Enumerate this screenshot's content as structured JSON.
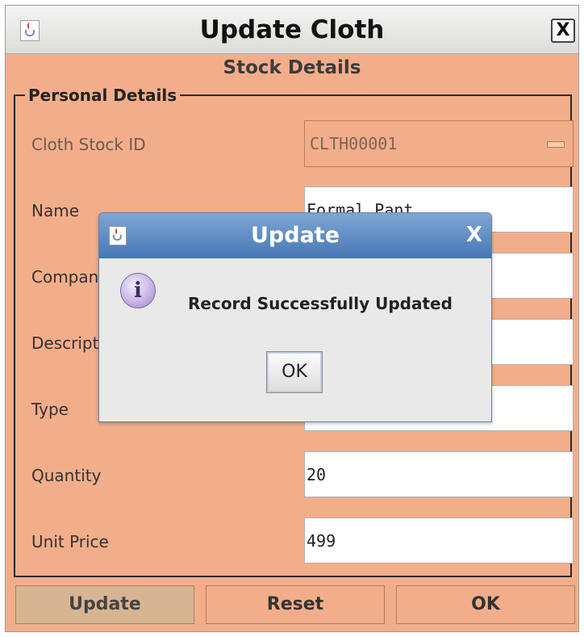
{
  "window": {
    "title": "Update Cloth",
    "close_label": "X",
    "subtitle": "Stock Details"
  },
  "form": {
    "group_label": "Personal Details",
    "fields": [
      {
        "label": "Cloth Stock ID",
        "value": "CLTH00001"
      },
      {
        "label": "Name",
        "value": "Formal Pant"
      },
      {
        "label": "Company",
        "value": ""
      },
      {
        "label": "Description",
        "value": ""
      },
      {
        "label": "Type",
        "value": ""
      },
      {
        "label": "Quantity",
        "value": "20"
      },
      {
        "label": "Unit Price",
        "value": "499"
      }
    ]
  },
  "buttons": {
    "update": "Update",
    "reset": "Reset",
    "ok": "OK"
  },
  "dialog": {
    "title": "Update",
    "close_label": "X",
    "icon": "info-icon",
    "icon_glyph": "i",
    "message": "Record Successfully Updated",
    "ok": "OK"
  },
  "colors": {
    "form_background": "#f2ae8a",
    "dialog_title_bar": "#4677b6",
    "update_button_active": "#d8b592"
  }
}
